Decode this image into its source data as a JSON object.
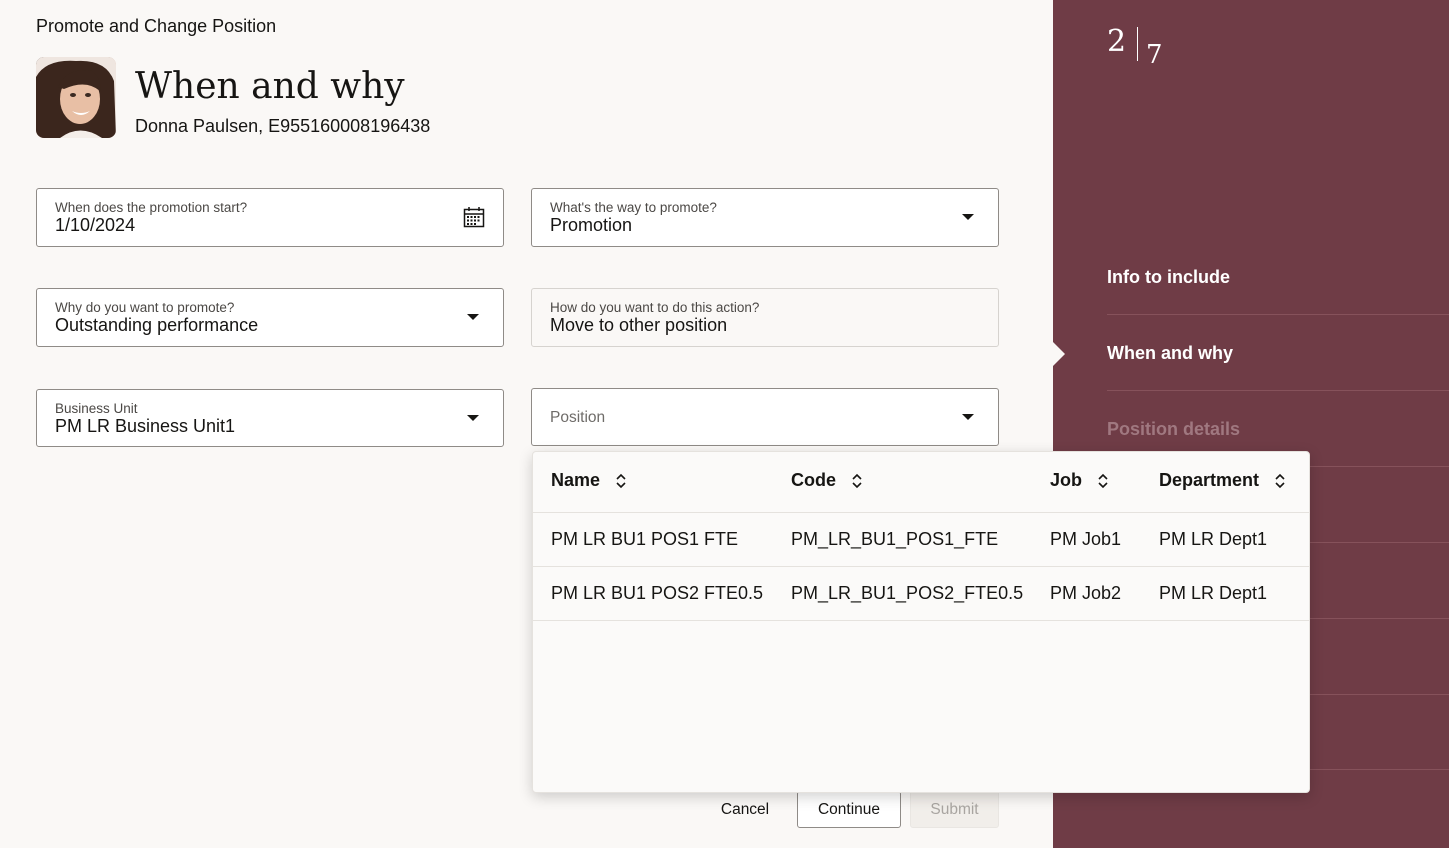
{
  "header": {
    "flow_title": "Promote and Change Position",
    "page_title": "When and why",
    "person": "Donna Paulsen, E955160008196438"
  },
  "form": {
    "start_date": {
      "label": "When does the promotion start?",
      "value": "1/10/2024"
    },
    "way": {
      "label": "What's the way to promote?",
      "value": "Promotion"
    },
    "reason": {
      "label": "Why do you want to promote?",
      "value": "Outstanding performance"
    },
    "action": {
      "label": "How do you want to do this action?",
      "value": "Move to other position"
    },
    "business_unit": {
      "label": "Business Unit",
      "value": "PM LR Business Unit1"
    },
    "position": {
      "placeholder": "Position"
    }
  },
  "popup": {
    "columns": [
      "Name",
      "Code",
      "Job",
      "Department"
    ],
    "rows": [
      {
        "name": "PM LR BU1 POS1 FTE",
        "code": "PM_LR_BU1_POS1_FTE",
        "job": "PM Job1",
        "department": "PM LR Dept1"
      },
      {
        "name": "PM LR BU1 POS2 FTE0.5",
        "code": "PM_LR_BU1_POS2_FTE0.5",
        "job": "PM Job2",
        "department": "PM LR Dept1"
      }
    ]
  },
  "buttons": {
    "cancel": "Cancel",
    "continue": "Continue",
    "submit": "Submit"
  },
  "sidebar": {
    "step_current": "2",
    "step_total": "7",
    "items": [
      {
        "label": "Info to include",
        "state": "completed"
      },
      {
        "label": "When and why",
        "state": "active"
      },
      {
        "label": "Position details",
        "state": "upcoming"
      }
    ]
  },
  "colors": {
    "sidebar_bg": "#6f3c46",
    "page_bg": "#faf8f6",
    "upcoming_text": "#a07880"
  }
}
